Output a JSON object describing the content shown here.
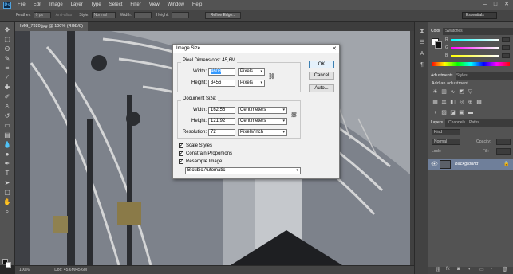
{
  "menubar": {
    "logo": "Ps",
    "items": [
      "File",
      "Edit",
      "Image",
      "Layer",
      "Type",
      "Select",
      "Filter",
      "View",
      "Window",
      "Help"
    ]
  },
  "options": {
    "feather_label": "Feather:",
    "feather_value": "0 px",
    "antialias_label": "Anti-alias",
    "style_label": "Style:",
    "style_value": "Normal",
    "width_label": "Width:",
    "height_label": "Height:",
    "refine_label": "Refine Edge...",
    "workspace": "Essentials"
  },
  "document": {
    "tab_label": "IMG_7320.jpg @ 100% (RGB/8)",
    "zoom": "100%",
    "doc_info": "Doc: 45,6M/45,6M"
  },
  "panels": {
    "color_tab": "Color",
    "swatches_tab": "Swatches",
    "channels": [
      "R",
      "G",
      "B"
    ],
    "adjustments_tab": "Adjustments",
    "styles_tab": "Styles",
    "add_adjustment": "Add an adjustment",
    "layers_tab": "Layers",
    "channels_tab": "Channels",
    "paths_tab": "Paths",
    "kind_label": "Kind",
    "blend_mode": "Normal",
    "opacity_label": "Opacity:",
    "lock_label": "Lock:",
    "fill_label": "Fill:",
    "layer_name": "Background"
  },
  "dialog": {
    "title": "Image Size",
    "pixel_dimensions_label": "Pixel Dimensions: 45,6M",
    "px_width_label": "Width:",
    "px_width_value": "4608",
    "px_width_unit": "Pixels",
    "px_height_label": "Height:",
    "px_height_value": "3456",
    "px_height_unit": "Pixels",
    "document_size_label": "Document Size:",
    "doc_width_label": "Width:",
    "doc_width_value": "162,56",
    "doc_width_unit": "Centimeters",
    "doc_height_label": "Height:",
    "doc_height_value": "121,92",
    "doc_height_unit": "Centimeters",
    "resolution_label": "Resolution:",
    "resolution_value": "72",
    "resolution_unit": "Pixels/Inch",
    "scale_styles": "Scale Styles",
    "constrain": "Constrain Proportions",
    "resample": "Resample Image:",
    "resample_method": "Bicubic Automatic",
    "ok": "OK",
    "cancel": "Cancel",
    "auto": "Auto..."
  }
}
